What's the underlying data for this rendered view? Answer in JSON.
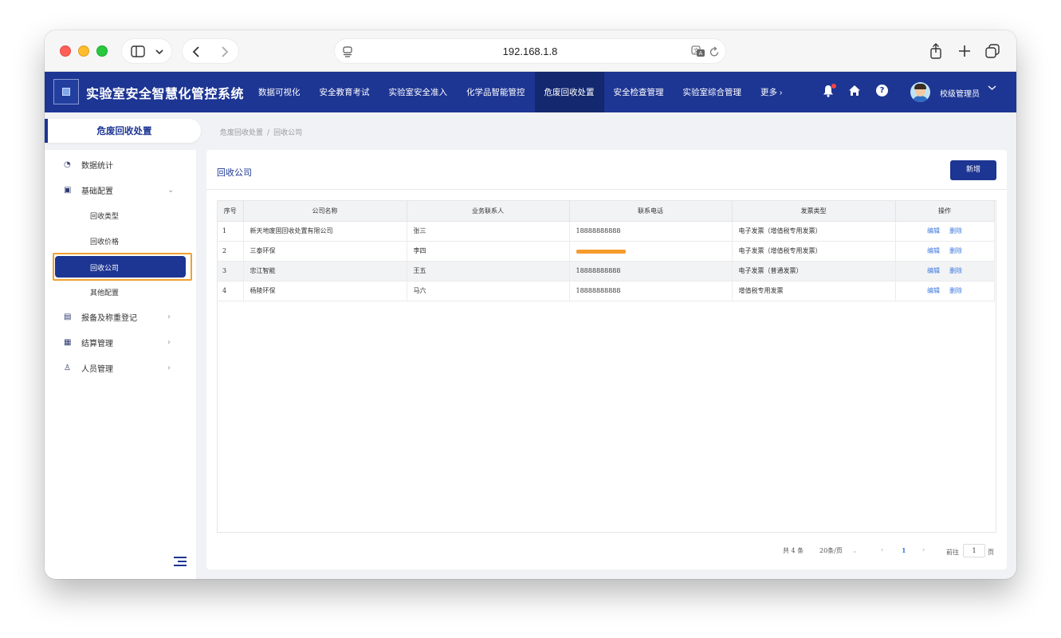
{
  "browser": {
    "url": "192.168.1.8"
  },
  "app": {
    "title": "实验室安全智慧化管控系统",
    "nav": [
      {
        "label": "数据可视化"
      },
      {
        "label": "安全教育考试"
      },
      {
        "label": "实验室安全准入"
      },
      {
        "label": "化学品智能管控"
      },
      {
        "label": "危废回收处置"
      },
      {
        "label": "安全检查管理"
      },
      {
        "label": "实验室综合管理"
      },
      {
        "label": "更多 ›"
      }
    ],
    "active_nav": "危废回收处置",
    "user": "校级管理员"
  },
  "sidebar": {
    "header": "危废回收处置",
    "items": {
      "stats": "数据统计",
      "basic": "基础配置",
      "sub_type": "回收类型",
      "sub_price": "回收价格",
      "sub_company": "回收公司",
      "sub_other": "其他配置",
      "report": "报备及称重登记",
      "settle": "结算管理",
      "staff": "人员管理"
    }
  },
  "breadcrumb": {
    "parent": "危废回收处置",
    "separator": "/",
    "current": "回收公司"
  },
  "card": {
    "title": "回收公司",
    "add_button": "新增"
  },
  "table": {
    "headers": {
      "idx": "序号",
      "company": "公司名称",
      "contact": "业务联系人",
      "phone": "联系电话",
      "invoice": "发票类型",
      "ops": "操作"
    },
    "rows": [
      {
        "idx": "1",
        "company": "新天地废固回收处置有限公司",
        "contact": "张三",
        "phone": "18888888888",
        "invoice": "电子发票（增值税专用发票）"
      },
      {
        "idx": "2",
        "company": "三泰环保",
        "contact": "李四",
        "phone": "",
        "invoice": "电子发票（增值税专用发票）"
      },
      {
        "idx": "3",
        "company": "忠江智能",
        "contact": "王五",
        "phone": "18888888888",
        "invoice": "电子发票（普通发票）"
      },
      {
        "idx": "4",
        "company": "杨陵环保",
        "contact": "马六",
        "phone": "18888888888",
        "invoice": "增值税专用发票"
      }
    ],
    "edit_label": "编辑",
    "delete_label": "删除"
  },
  "pagination": {
    "total": "共 4 条",
    "page_size": "20条/页",
    "current_page": "1",
    "goto_label": "前往",
    "goto_value": "1",
    "page_suffix": "页"
  },
  "colors": {
    "primary": "#1d3593",
    "highlight_outline": "#f0a030",
    "link": "#3d7ae0"
  }
}
